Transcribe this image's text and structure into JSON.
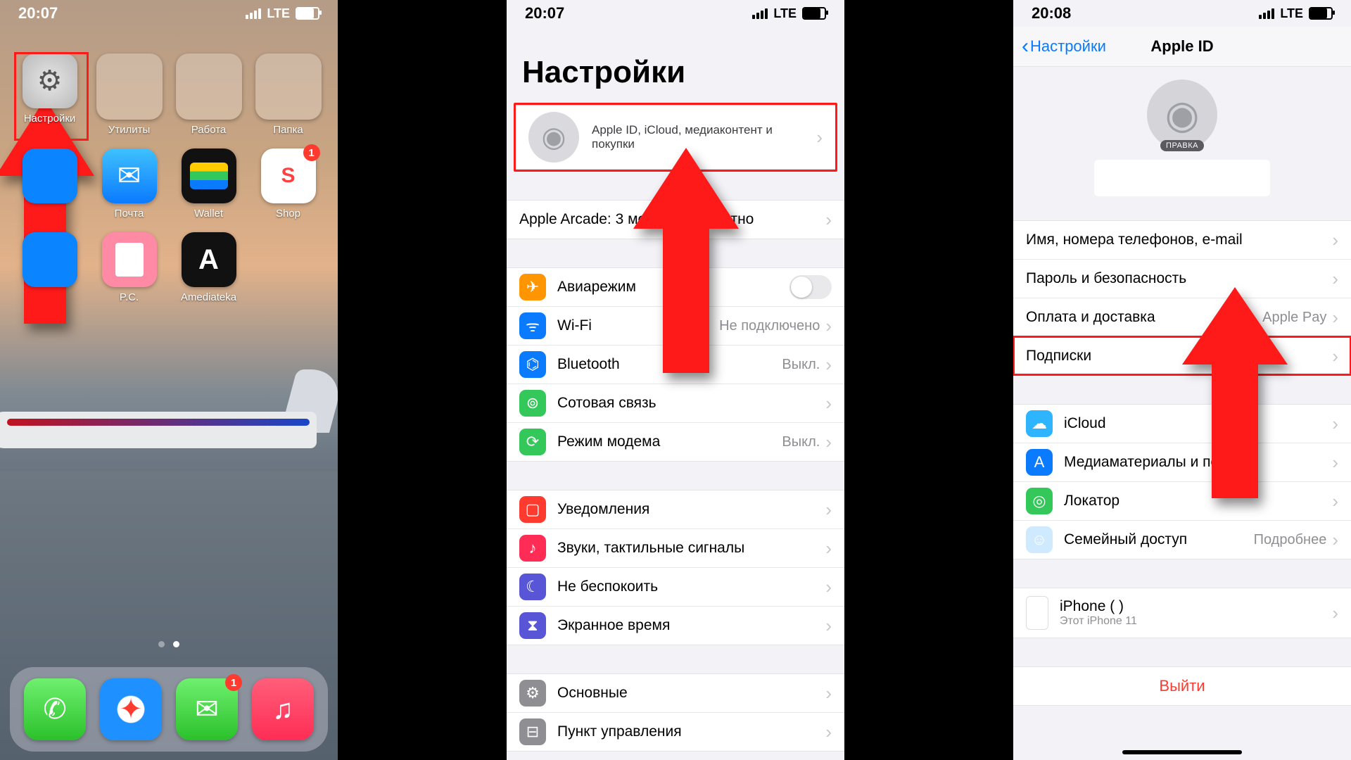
{
  "status": {
    "time1": "20:07",
    "time2": "20:07",
    "time3": "20:08",
    "net": "LTE"
  },
  "home": {
    "row1": [
      {
        "label": "Настройки",
        "kind": "settings"
      },
      {
        "label": "Утилиты",
        "kind": "folder"
      },
      {
        "label": "Работа",
        "kind": "folder"
      },
      {
        "label": "Папка",
        "kind": "folder"
      }
    ],
    "row2": [
      {
        "label": "",
        "kind": "blue"
      },
      {
        "label": "Почта",
        "kind": "mail"
      },
      {
        "label": "Wallet",
        "kind": "wallet"
      },
      {
        "label": "Shop",
        "kind": "shop",
        "badge": "1"
      }
    ],
    "row3": [
      {
        "label": "",
        "kind": "blue"
      },
      {
        "label": "P.C.",
        "kind": "pc"
      },
      {
        "label": "Amediateka",
        "kind": "amed"
      }
    ],
    "dock": [
      {
        "kind": "phoneapp"
      },
      {
        "kind": "safari"
      },
      {
        "kind": "messages",
        "badge": "1"
      },
      {
        "kind": "music"
      }
    ]
  },
  "settings": {
    "title": "Настройки",
    "apple_sub": "Apple ID, iCloud, медиаконтент и покупки",
    "arcade": "Apple Arcade: 3 месяца бесплатно",
    "items": [
      {
        "label": "Авиарежим",
        "color": "#ff9500",
        "glyph": "✈",
        "switch": true
      },
      {
        "label": "Wi-Fi",
        "color": "#0a7aff",
        "glyph": "ᯤ",
        "value": "Не подключено"
      },
      {
        "label": "Bluetooth",
        "color": "#0a7aff",
        "glyph": "⌬",
        "value": "Выкл."
      },
      {
        "label": "Сотовая связь",
        "color": "#34c759",
        "glyph": "⊚",
        "value": ""
      },
      {
        "label": "Режим модема",
        "color": "#34c759",
        "glyph": "⟳",
        "value": "Выкл."
      }
    ],
    "items2": [
      {
        "label": "Уведомления",
        "color": "#ff3b30",
        "glyph": "▢"
      },
      {
        "label": "Звуки, тактильные сигналы",
        "color": "#ff2d55",
        "glyph": "♪"
      },
      {
        "label": "Не беспокоить",
        "color": "#5856d6",
        "glyph": "☾"
      },
      {
        "label": "Экранное время",
        "color": "#5856d6",
        "glyph": "⧗"
      }
    ],
    "items3": [
      {
        "label": "Основные",
        "color": "#8e8e93",
        "glyph": "⚙"
      },
      {
        "label": "Пункт управления",
        "color": "#8e8e93",
        "glyph": "⊟"
      }
    ]
  },
  "appleid": {
    "back": "Настройки",
    "title": "Apple ID",
    "edit": "ПРАВКА",
    "g1": [
      {
        "label": "Имя, номера телефонов, e-mail"
      },
      {
        "label": "Пароль и безопасность"
      },
      {
        "label": "Оплата и доставка",
        "value": "Apple Pay"
      },
      {
        "label": "Подписки",
        "highlight": true
      }
    ],
    "g2": [
      {
        "label": "iCloud",
        "color": "#2fb4ff",
        "glyph": "☁"
      },
      {
        "label": "Медиаматериалы и покупки",
        "color": "#0a7aff",
        "glyph": "A"
      },
      {
        "label": "Локатор",
        "color": "#34c759",
        "glyph": "◎"
      },
      {
        "label": "Семейный доступ",
        "color": "#cfe9ff",
        "glyph": "☺",
        "value": "Подробнее"
      }
    ],
    "device": {
      "name": "iPhone (               )",
      "sub": "Этот iPhone 11"
    },
    "signout": "Выйти"
  }
}
